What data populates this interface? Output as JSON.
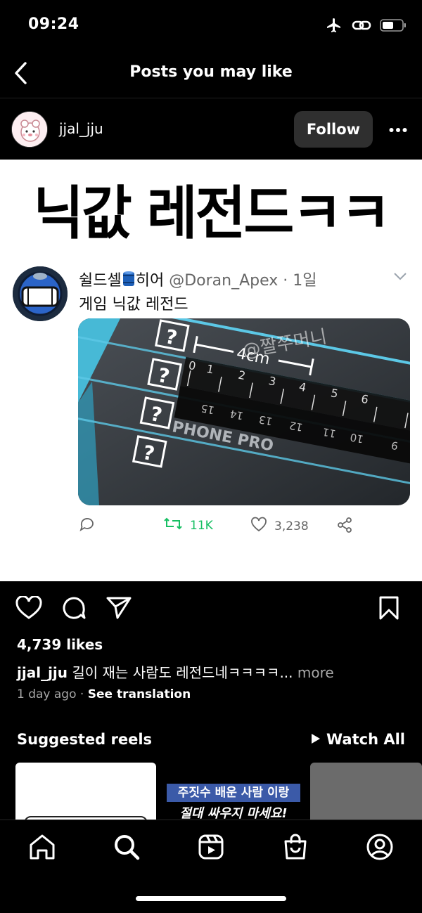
{
  "status_bar": {
    "time": "09:24",
    "icons": [
      "airplane-icon",
      "link-icon",
      "battery-icon"
    ]
  },
  "nav": {
    "title": "Posts you may like",
    "back_icon": "chevron-left-icon"
  },
  "post": {
    "username": "jjal_jju",
    "follow_label": "Follow",
    "image": {
      "title": "닉값 레전드ㅋㅋ",
      "tweet": {
        "name": "쉴드셀",
        "name_suffix": "히어",
        "handle": "@Doran_Apex · 1일",
        "text": "게임 닉값 레전드",
        "photo_watermark": "@짤쭈머니",
        "ruler_label": "4cm",
        "retweets": "11K",
        "likes": "3,238"
      }
    },
    "likes_text": "4,739 likes",
    "caption_user": "jjal_jju",
    "caption_text": " 길이 재는 사람도 레전드네ㅋㅋㅋㅋ...",
    "caption_more": " more",
    "time_ago": "1 day ago",
    "meta_sep": " · ",
    "see_translation": "See translation"
  },
  "reels": {
    "title": "Suggested reels",
    "watch_all": "Watch All",
    "items": [
      {
        "caption_line1": "",
        "caption_line2": ""
      },
      {
        "caption_line1": "주짓수 배운 사람 이랑",
        "caption_line2": "절대 싸우지 마세요!"
      },
      {
        "caption_line1": "",
        "caption_line2": ""
      }
    ]
  },
  "tab_bar": {
    "tabs": [
      "home-icon",
      "search-icon",
      "reels-icon",
      "shop-icon",
      "profile-icon"
    ]
  },
  "colors": {
    "background": "#000000",
    "follow_bg": "#2f2f2f",
    "retweet_green": "#17bf63",
    "muted": "#a8a8a8"
  }
}
